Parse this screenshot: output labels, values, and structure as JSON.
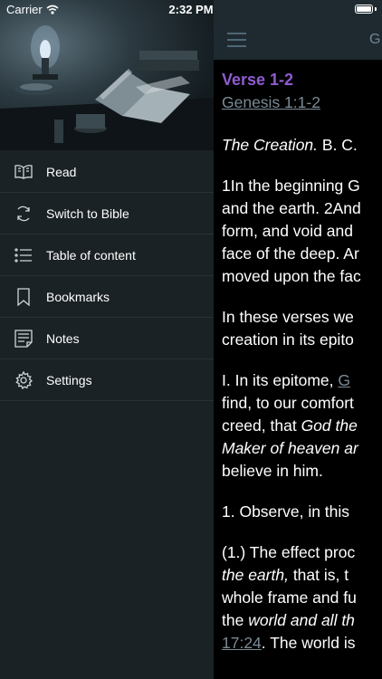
{
  "status_bar": {
    "carrier": "Carrier",
    "time": "2:32 PM"
  },
  "sidebar": {
    "items": [
      {
        "label": "Read",
        "icon": "book-open-icon"
      },
      {
        "label": "Switch to Bible",
        "icon": "refresh-icon"
      },
      {
        "label": "Table of content",
        "icon": "list-icon"
      },
      {
        "label": "Bookmarks",
        "icon": "bookmark-icon"
      },
      {
        "label": "Notes",
        "icon": "notes-icon"
      },
      {
        "label": "Settings",
        "icon": "gear-icon"
      }
    ]
  },
  "navbar": {
    "title": "G"
  },
  "reader": {
    "verse_title": "Verse 1-2",
    "verse_ref": "Genesis 1:1-2",
    "intro_italic": "The Creation.",
    "intro_rest": " B. C.",
    "p1": [
      "1In the beginning G",
      "and the earth. 2And",
      "form, and void and",
      "face of the deep. Ar",
      "moved upon the fac"
    ],
    "p2": [
      "In these verses we",
      "creation in its epito"
    ],
    "p3_l1_a": "I. In its epitome, ",
    "p3_l1_link": "G",
    "p3_l2": "find, to our comfort",
    "p3_l3_a": "creed, that ",
    "p3_l3_i": "God the",
    "p3_l4_i": "Maker of heaven ar",
    "p3_l5": "believe in him.",
    "p4": "1. Observe, in this",
    "p5_l1": "(1.) The effect proc",
    "p5_l2_i": "the earth,",
    "p5_l2_b": " that is, t",
    "p5_l3": "whole frame and fu",
    "p5_l4_a": "the ",
    "p5_l4_i": "world and all th",
    "p5_l5_link": "17:24",
    "p5_l5_b": ". The world is"
  }
}
